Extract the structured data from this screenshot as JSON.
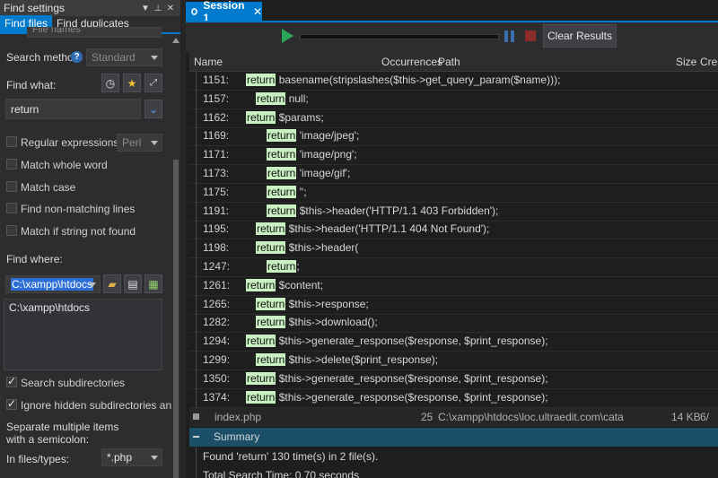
{
  "panel": {
    "title": "Find settings",
    "tabs": [
      "Find files",
      "Find duplicates"
    ],
    "partial_top": "File names",
    "search_method_label": "Search method:",
    "search_method_value": "Standard",
    "find_what_label": "Find what:",
    "find_what_value": "return",
    "options": [
      {
        "label": "Regular expressions:",
        "checked": false
      },
      {
        "label": "Match whole word",
        "checked": false
      },
      {
        "label": "Match case",
        "checked": false
      },
      {
        "label": "Find non-matching lines",
        "checked": false
      },
      {
        "label": "Match if string not found",
        "checked": false
      }
    ],
    "regex_engine": "Perl",
    "find_where_label": "Find where:",
    "find_where_value": "C:\\xampp\\htdocs",
    "find_where_list": "C:\\xampp\\htdocs",
    "search_subdirs": "Search subdirectories",
    "ignore_hidden": "Ignore hidden subdirectories and files",
    "separate_note": "Separate multiple items with a semicolon:",
    "in_files_label": "In files/types:",
    "in_files_value": "*.php"
  },
  "session": {
    "tab_label": "Session 1",
    "clear_button": "Clear Results"
  },
  "columns": [
    "Name",
    "Occurrences",
    "Path",
    "Size",
    "Crea"
  ],
  "results": [
    {
      "line": "1151:",
      "indent": 1,
      "kw": "return",
      "rest": " basename(stripslashes($this->get_query_param($name)));"
    },
    {
      "line": "1157:",
      "indent": 2,
      "kw": "return",
      "rest": " null;"
    },
    {
      "line": "1162:",
      "indent": 1,
      "kw": "return",
      "rest": " $params;"
    },
    {
      "line": "1169:",
      "indent": 3,
      "kw": "return",
      "rest": " 'image/jpeg';"
    },
    {
      "line": "1171:",
      "indent": 3,
      "kw": "return",
      "rest": " 'image/png';"
    },
    {
      "line": "1173:",
      "indent": 3,
      "kw": "return",
      "rest": " 'image/gif';"
    },
    {
      "line": "1175:",
      "indent": 3,
      "kw": "return",
      "rest": " '';"
    },
    {
      "line": "1191:",
      "indent": 3,
      "kw": "return",
      "rest": " $this->header('HTTP/1.1 403 Forbidden');"
    },
    {
      "line": "1195:",
      "indent": 2,
      "kw": "return",
      "rest": " $this->header('HTTP/1.1 404 Not Found');"
    },
    {
      "line": "1198:",
      "indent": 2,
      "kw": "return",
      "rest": " $this->header("
    },
    {
      "line": "1247:",
      "indent": 3,
      "kw": "return",
      "rest": ";"
    },
    {
      "line": "1261:",
      "indent": 1,
      "kw": "return",
      "rest": " $content;"
    },
    {
      "line": "1265:",
      "indent": 2,
      "kw": "return",
      "rest": " $this->response;"
    },
    {
      "line": "1282:",
      "indent": 2,
      "kw": "return",
      "rest": " $this->download();"
    },
    {
      "line": "1294:",
      "indent": 1,
      "kw": "return",
      "rest": " $this->generate_response($response, $print_response);"
    },
    {
      "line": "1299:",
      "indent": 2,
      "kw": "return",
      "rest": " $this->delete($print_response);"
    },
    {
      "line": "1350:",
      "indent": 1,
      "kw": "return",
      "rest": " $this->generate_response($response, $print_response);"
    },
    {
      "line": "1374:",
      "indent": 1,
      "kw": "return",
      "rest": " $this->generate_response($response, $print_response);"
    }
  ],
  "file_row": {
    "name": "index.php",
    "occurrences": "25",
    "path": "C:\\xampp\\htdocs\\loc.ultraedit.com\\catalog\\c",
    "size": "14 KB",
    "created": "6/"
  },
  "summary": {
    "label": "Summary",
    "found": "Found 'return' 130 time(s) in 2 file(s).",
    "time": "Total Search Time: 0.70 seconds"
  }
}
